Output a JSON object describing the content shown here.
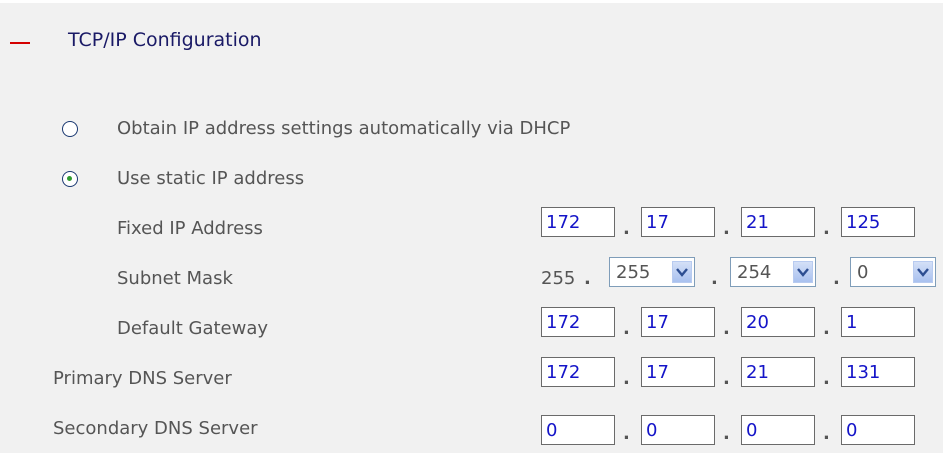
{
  "section": {
    "title": "TCP/IP Configuration",
    "toggle_icon": "collapse-minus-icon"
  },
  "options": {
    "dhcp_label": "Obtain IP address settings automatically via DHCP",
    "static_label": "Use static IP address",
    "selected": "static"
  },
  "fixed_ip": {
    "label": "Fixed IP Address",
    "octets": [
      "172",
      "17",
      "21",
      "125"
    ]
  },
  "subnet_mask": {
    "label": "Subnet Mask",
    "first_octet": "255",
    "octets": [
      "255",
      "254",
      "0"
    ]
  },
  "default_gateway": {
    "label": "Default Gateway",
    "octets": [
      "172",
      "17",
      "20",
      "1"
    ]
  },
  "primary_dns": {
    "label": "Primary DNS Server",
    "octets": [
      "172",
      "17",
      "21",
      "131"
    ]
  },
  "secondary_dns": {
    "label": "Secondary DNS Server",
    "octets": [
      "0",
      "0",
      "0",
      "0"
    ]
  },
  "separator": "."
}
